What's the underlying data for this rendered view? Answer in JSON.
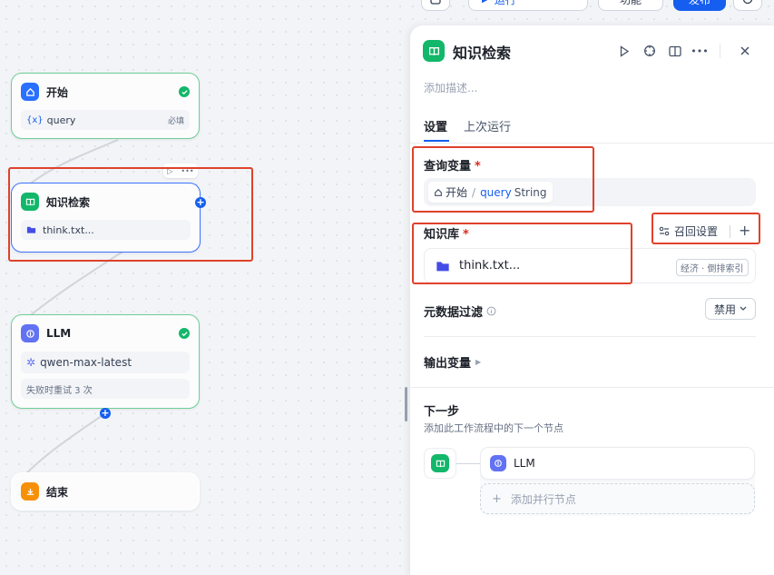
{
  "toolbar": {
    "run_label": "运行",
    "features_label": "功能",
    "publish_label": "发布"
  },
  "canvas": {
    "start_node": {
      "title": "开始",
      "var_name": "query",
      "var_required": "必填"
    },
    "kr_node": {
      "title": "知识检索",
      "file": "think.txt..."
    },
    "llm_node": {
      "title": "LLM",
      "model": "qwen-max-latest",
      "retry": "失败时重试 3 次"
    },
    "end_node": {
      "title": "结束"
    }
  },
  "panel": {
    "title": "知识检索",
    "description_placeholder": "添加描述...",
    "tabs": [
      {
        "label": "设置",
        "active": true
      },
      {
        "label": "上次运行",
        "active": false
      }
    ],
    "query_var": {
      "label": "查询变量",
      "required_mark": "*",
      "source": "开始",
      "separator": "/",
      "var": "query",
      "type": "String"
    },
    "knowledge": {
      "label": "知识库",
      "required_mark": "*",
      "recall_label": "召回设置",
      "file": "think.txt...",
      "badge": "经济 · 倒排索引"
    },
    "metadata": {
      "label": "元数据过滤",
      "value": "禁用"
    },
    "output": {
      "label": "输出变量"
    },
    "next": {
      "title": "下一步",
      "desc": "添加此工作流程中的下一个节点",
      "llm_label": "LLM",
      "add_parallel": "添加并行节点"
    }
  },
  "colors": {
    "accent": "#155eef",
    "kr_green": "#12b76a",
    "highlight_red": "#e0412b"
  }
}
